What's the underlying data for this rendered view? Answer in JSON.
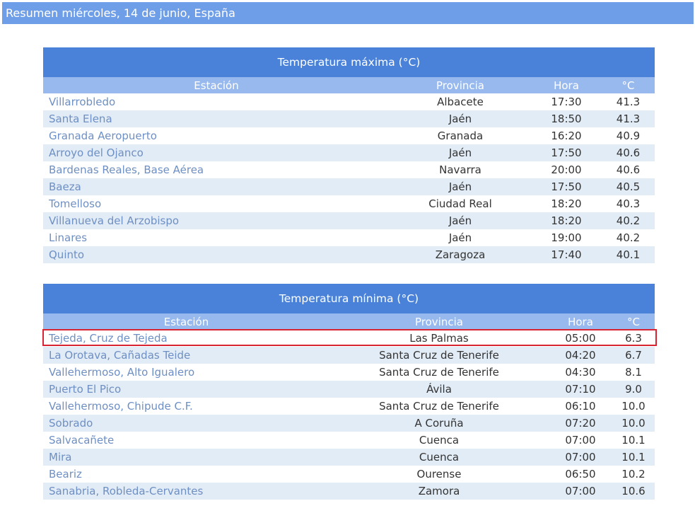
{
  "header": {
    "title": "Resumen miércoles, 14 de junio, España"
  },
  "tables": {
    "max": {
      "title": "Temperatura máxima (°C)",
      "columns": {
        "station": "Estación",
        "province": "Provincia",
        "time": "Hora",
        "temp": "°C"
      },
      "rows": [
        {
          "station": "Villarrobledo",
          "province": "Albacete",
          "time": "17:30",
          "temp": "41.3"
        },
        {
          "station": "Santa Elena",
          "province": "Jaén",
          "time": "18:50",
          "temp": "41.3"
        },
        {
          "station": "Granada Aeropuerto",
          "province": "Granada",
          "time": "16:20",
          "temp": "40.9"
        },
        {
          "station": "Arroyo del Ojanco",
          "province": "Jaén",
          "time": "17:50",
          "temp": "40.6"
        },
        {
          "station": "Bardenas Reales, Base Aérea",
          "province": "Navarra",
          "time": "20:00",
          "temp": "40.6"
        },
        {
          "station": "Baeza",
          "province": "Jaén",
          "time": "17:50",
          "temp": "40.5"
        },
        {
          "station": "Tomelloso",
          "province": "Ciudad Real",
          "time": "18:20",
          "temp": "40.3"
        },
        {
          "station": "Villanueva del Arzobispo",
          "province": "Jaén",
          "time": "18:20",
          "temp": "40.2"
        },
        {
          "station": "Linares",
          "province": "Jaén",
          "time": "19:00",
          "temp": "40.2"
        },
        {
          "station": "Quinto",
          "province": "Zaragoza",
          "time": "17:40",
          "temp": "40.1"
        }
      ]
    },
    "min": {
      "title": "Temperatura mínima (°C)",
      "columns": {
        "station": "Estación",
        "province": "Provincia",
        "time": "Hora",
        "temp": "°C"
      },
      "rows": [
        {
          "station": "Tejeda, Cruz de Tejeda",
          "province": "Las Palmas",
          "time": "05:00",
          "temp": "6.3"
        },
        {
          "station": "La Orotava, Cañadas Teide",
          "province": "Santa Cruz de Tenerife",
          "time": "04:20",
          "temp": "6.7"
        },
        {
          "station": "Vallehermoso, Alto Igualero",
          "province": "Santa Cruz de Tenerife",
          "time": "04:30",
          "temp": "8.1"
        },
        {
          "station": "Puerto El Pico",
          "province": "Ávila",
          "time": "07:10",
          "temp": "9.0"
        },
        {
          "station": "Vallehermoso, Chipude C.F.",
          "province": "Santa Cruz de Tenerife",
          "time": "06:10",
          "temp": "10.0"
        },
        {
          "station": "Sobrado",
          "province": "A Coruña",
          "time": "07:20",
          "temp": "10.0"
        },
        {
          "station": "Salvacañete",
          "province": "Cuenca",
          "time": "07:00",
          "temp": "10.1"
        },
        {
          "station": "Mira",
          "province": "Cuenca",
          "time": "07:00",
          "temp": "10.1"
        },
        {
          "station": "Beariz",
          "province": "Ourense",
          "time": "06:50",
          "temp": "10.2"
        },
        {
          "station": "Sanabria, Robleda-Cervantes",
          "province": "Zamora",
          "time": "07:00",
          "temp": "10.6"
        }
      ]
    }
  },
  "colors": {
    "header_bar": "#6e9ee8",
    "title_bar": "#4a82d9",
    "column_header": "#98b9ee",
    "row_stripe": "#e2ecf6",
    "station_link": "#6e8fc3",
    "highlight": "#d82332"
  },
  "highlight": {
    "table": "min",
    "row": 0
  }
}
